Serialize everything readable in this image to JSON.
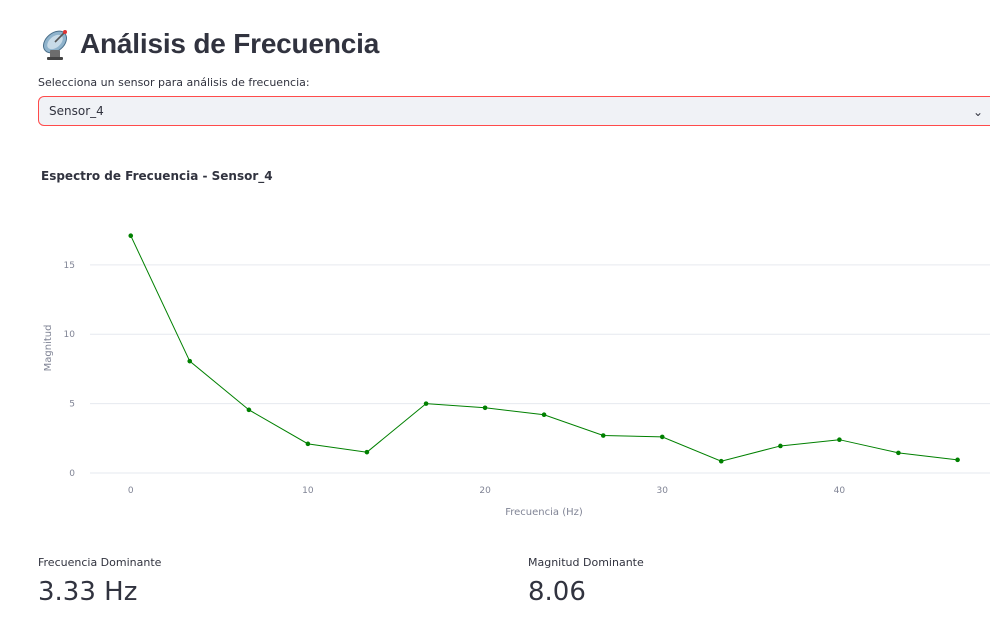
{
  "page": {
    "title": "Análisis de Frecuencia",
    "title_icon": "satellite-antenna-icon"
  },
  "sensor_select": {
    "label": "Selecciona un sensor para análisis de frecuencia:",
    "value": "Sensor_4"
  },
  "chart_data": {
    "type": "line",
    "title": "Espectro de Frecuencia - Sensor_4",
    "xlabel": "Frecuencia (Hz)",
    "ylabel": "Magnitud",
    "x": [
      0,
      3.33,
      6.67,
      10,
      13.33,
      16.67,
      20,
      23.33,
      26.67,
      30,
      33.33,
      36.67,
      40,
      43.33,
      46.67
    ],
    "values": [
      17.1,
      8.06,
      4.55,
      2.1,
      1.5,
      5.0,
      4.7,
      4.2,
      2.7,
      2.6,
      0.85,
      1.95,
      2.4,
      1.45,
      0.95
    ],
    "xlim": [
      -2.3,
      48.5
    ],
    "ylim": [
      0,
      17.8
    ],
    "xticks": [
      0,
      10,
      20,
      30,
      40
    ],
    "yticks": [
      0,
      5,
      10,
      15
    ],
    "grid": "horizontal",
    "color": "#008000"
  },
  "metrics": [
    {
      "label": "Frecuencia Dominante",
      "value": "3.33 Hz"
    },
    {
      "label": "Magnitud Dominante",
      "value": "8.06"
    }
  ]
}
